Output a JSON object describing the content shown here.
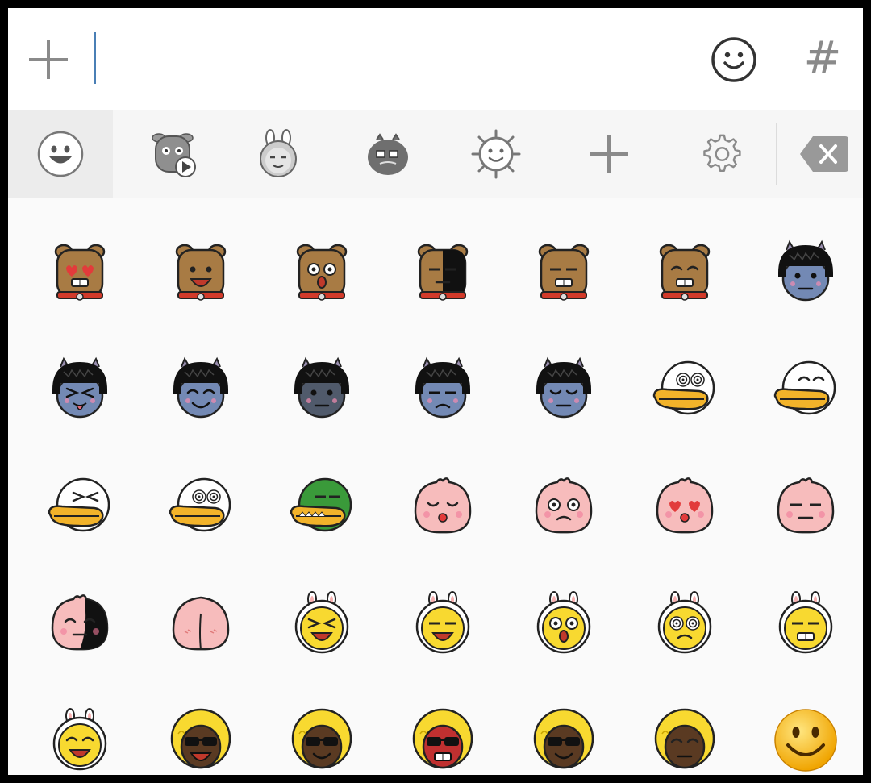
{
  "input": {
    "value": "",
    "placeholder": ""
  },
  "header": {
    "hash_label": "#"
  },
  "tabs": [
    {
      "icon": "smiley-icon",
      "active": true
    },
    {
      "icon": "animated-sticker-icon",
      "active": false
    },
    {
      "icon": "bunny-sticker-icon",
      "active": false
    },
    {
      "icon": "tube-sticker-icon",
      "active": false
    },
    {
      "icon": "sun-sticker-icon",
      "active": false
    },
    {
      "icon": "plus-icon",
      "active": false
    },
    {
      "icon": "gear-icon",
      "active": false
    },
    {
      "icon": "backspace-icon",
      "active": false
    }
  ],
  "colors": {
    "caret": "#4a7fb5",
    "icon_gray": "#8a8a8a",
    "dog_brown": "#a87b44",
    "muzi_yellow": "#f8d930",
    "peach_pink": "#f7bcbc",
    "neo_blue": "#7389b4",
    "duck_orange": "#f2b32a"
  },
  "emoticons": [
    {
      "name": "frodo-heart-eyes"
    },
    {
      "name": "frodo-laughing"
    },
    {
      "name": "frodo-surprised"
    },
    {
      "name": "frodo-shadow"
    },
    {
      "name": "frodo-sweat"
    },
    {
      "name": "frodo-crying"
    },
    {
      "name": "neo-blank"
    },
    {
      "name": "neo-tongue"
    },
    {
      "name": "neo-blush"
    },
    {
      "name": "neo-dark"
    },
    {
      "name": "neo-annoyed"
    },
    {
      "name": "neo-unamused"
    },
    {
      "name": "tube-dizzy"
    },
    {
      "name": "tube-smile"
    },
    {
      "name": "tube-laughing"
    },
    {
      "name": "tube-spiral-eyes"
    },
    {
      "name": "tube-angry-green"
    },
    {
      "name": "apeach-sparkle"
    },
    {
      "name": "apeach-teary"
    },
    {
      "name": "apeach-heart-eyes"
    },
    {
      "name": "apeach-drool"
    },
    {
      "name": "apeach-shadow"
    },
    {
      "name": "apeach-back"
    },
    {
      "name": "muzi-laughing"
    },
    {
      "name": "muzi-big-smile"
    },
    {
      "name": "muzi-thumbs-up"
    },
    {
      "name": "muzi-dizzy"
    },
    {
      "name": "muzi-shocked"
    },
    {
      "name": "muzi-crying"
    },
    {
      "name": "jay-g-crying"
    },
    {
      "name": "jay-g-cool"
    },
    {
      "name": "jay-g-red"
    },
    {
      "name": "jay-g-rock"
    },
    {
      "name": "jay-g-sneaky"
    },
    {
      "name": "yellow-smiley"
    }
  ]
}
